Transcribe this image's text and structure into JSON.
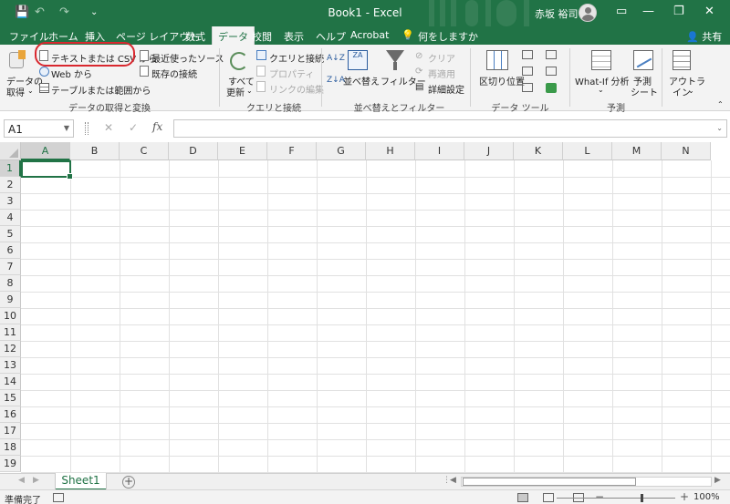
{
  "titlebar": {
    "title": "Book1  -  Excel",
    "user_name": "赤坂 裕司",
    "save_icon": "💾",
    "undo_icon": "↶",
    "redo_icon": "↷",
    "customize_icon": "⌄",
    "ribbon_display_icon": "▭",
    "minimize_icon": "—",
    "restore_icon": "❐",
    "close_icon": "✕"
  },
  "tabs": [
    "ファイル",
    "ホーム",
    "挿入",
    "ページ レイアウト",
    "数式",
    "データ",
    "校閲",
    "表示",
    "ヘルプ",
    "Acrobat"
  ],
  "tellme": {
    "icon": "💡",
    "label": "何をしますか"
  },
  "share_label": "共有",
  "ribbon": {
    "get_data": {
      "line1": "データの",
      "line2": "取得"
    },
    "from_text_csv": "テキストまたは CSV から",
    "from_web": "Web から",
    "from_table": "テーブルまたは範囲から",
    "recent_sources": "最近使ったソース",
    "existing_connections": "既存の接続",
    "group_get_transform": "データの取得と変換",
    "refresh_all": {
      "line1": "すべて",
      "line2": "更新"
    },
    "queries_connections": "クエリと接続",
    "properties": "プロパティ",
    "edit_links": "リンクの編集",
    "group_queries": "クエリと接続",
    "sort_az": "A↓Z",
    "sort_za": "Z↓A",
    "sort": "並べ替え",
    "filter": "フィルター",
    "clear": "クリア",
    "reapply": "再適用",
    "advanced": "詳細設定",
    "group_sort_filter": "並べ替えとフィルター",
    "text_to_columns": "区切り位置",
    "group_data_tools": "データ ツール",
    "whatif": "What-If 分析",
    "forecast_sheet": {
      "line1": "予測",
      "line2": "シート"
    },
    "group_forecast": "予測",
    "outline": {
      "line1": "アウトラ",
      "line2": "イン"
    }
  },
  "formula_bar": {
    "name_box": "A1",
    "cancel_icon": "✕",
    "enter_icon": "✓",
    "fx": "fx",
    "value": ""
  },
  "grid": {
    "columns": [
      "A",
      "B",
      "C",
      "D",
      "E",
      "F",
      "G",
      "H",
      "I",
      "J",
      "K",
      "L",
      "M",
      "N"
    ],
    "rows": [
      "1",
      "2",
      "3",
      "4",
      "5",
      "6",
      "7",
      "8",
      "9",
      "10",
      "11",
      "12",
      "13",
      "14",
      "15",
      "16",
      "17",
      "18",
      "19"
    ],
    "active_cell": "A1"
  },
  "sheets": {
    "tabs": [
      "Sheet1"
    ],
    "add_icon": "+"
  },
  "status": {
    "text": "準備完了",
    "zoom": "100%"
  }
}
